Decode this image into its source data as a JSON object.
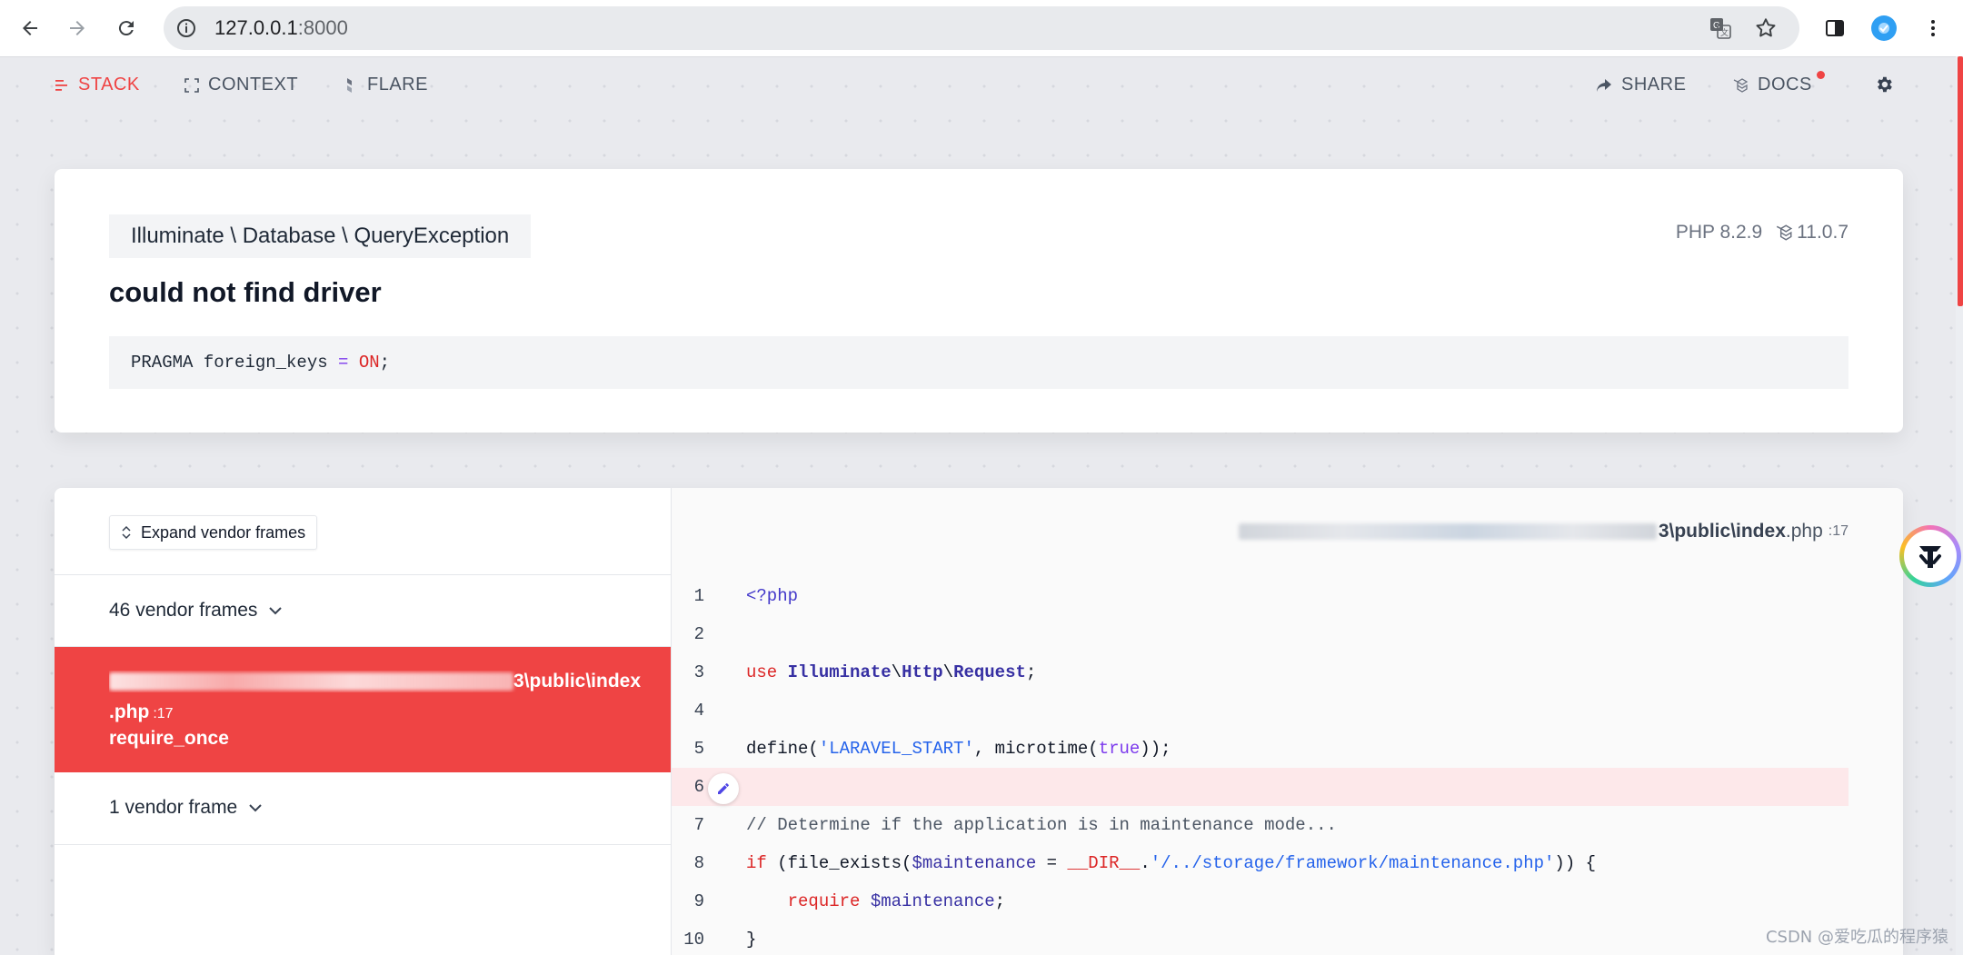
{
  "browser": {
    "url_host": "127.0.0.1",
    "url_port": ":8000"
  },
  "nav": {
    "stack": "STACK",
    "context": "CONTEXT",
    "flare": "FLARE",
    "share": "SHARE",
    "docs": "DOCS"
  },
  "error": {
    "exception_class": "Illuminate \\ Database \\ QueryException",
    "php_version": "PHP 8.2.9",
    "laravel_version": "11.0.7",
    "message": "could not find driver",
    "sql": {
      "keyword": "PRAGMA foreign_keys ",
      "operator": "=",
      "value": "ON",
      "end": ";"
    }
  },
  "frames": {
    "expand_label": "Expand vendor frames",
    "group_top": "46 vendor frames",
    "active_path_visible": "3\\public\\index",
    "active_ext": ".php",
    "active_line": "17",
    "active_method": "require_once",
    "group_bottom": "1 vendor frame"
  },
  "code": {
    "file_tail": "3\\public\\index",
    "file_ext": ".php",
    "file_line": "17",
    "line_numbers": [
      "1",
      "2",
      "3",
      "4",
      "5",
      "6",
      "7",
      "8",
      "9",
      "10"
    ],
    "l1": "<?php",
    "l3_use": "use",
    "l3_ns1": "Illuminate",
    "l3_ns2": "Http",
    "l3_ns3": "Request",
    "l3_sep": "\\",
    "l3_end": ";",
    "l5_a": "define(",
    "l5_str": "'LARAVEL_START'",
    "l5_b": ", microtime(",
    "l5_bool": "true",
    "l5_c": "));",
    "l7": "// Determine if the application is in maintenance mode...",
    "l8_if": "if",
    "l8_a": " (file_exists(",
    "l8_var": "$maintenance",
    "l8_b": " = ",
    "l8_dir": "__DIR__",
    "l8_c": ".",
    "l8_str": "'/../storage/framework/maintenance.php'",
    "l8_d": ")) {",
    "l9_req": "require",
    "l9_var": "$maintenance",
    "l9_end": ";",
    "l10": "}"
  },
  "watermark": "CSDN @爱吃瓜的程序猿",
  "colors": {
    "accent": "#ef4444",
    "background": "#e9eaee"
  }
}
